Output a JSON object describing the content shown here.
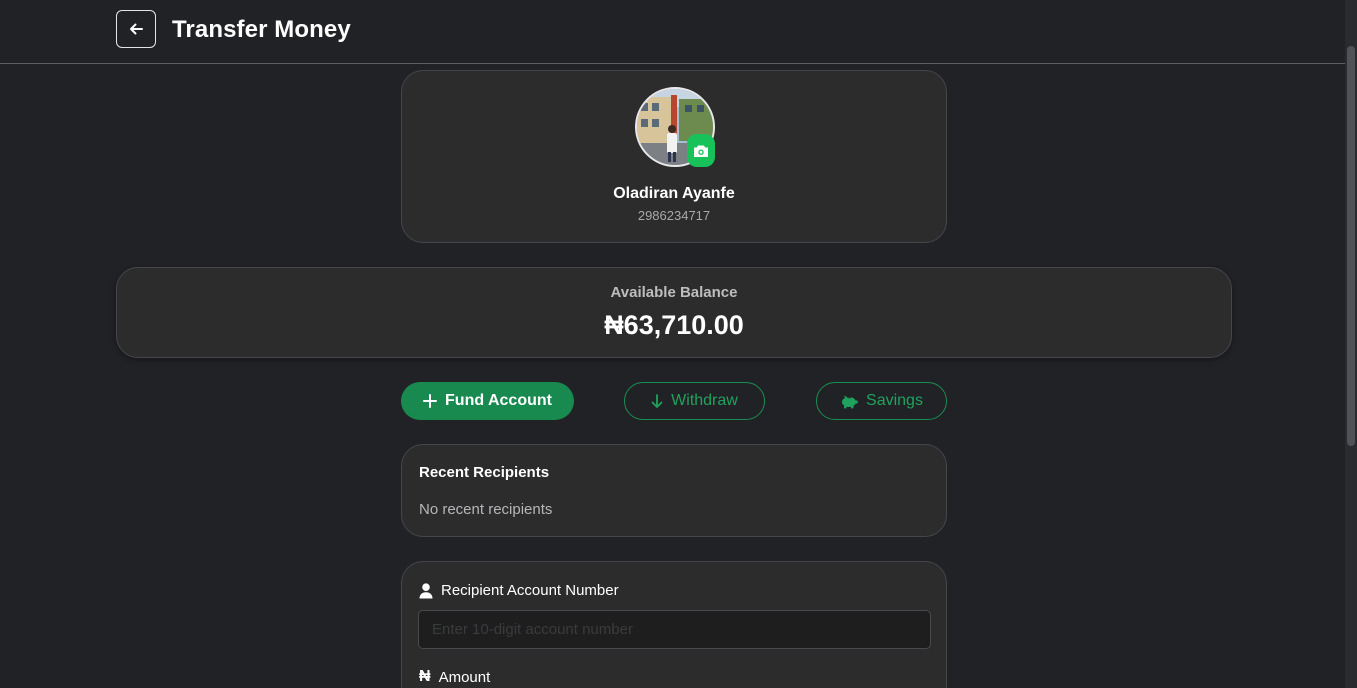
{
  "header": {
    "title": "Transfer Money"
  },
  "profile": {
    "name": "Oladiran Ayanfe",
    "account_number": "2986234717"
  },
  "balance": {
    "label": "Available Balance",
    "amount": "₦63,710.00"
  },
  "actions": {
    "fund_label": "Fund Account",
    "withdraw_label": "Withdraw",
    "savings_label": "Savings"
  },
  "recent": {
    "title": "Recent Recipients",
    "empty_text": "No recent recipients"
  },
  "form": {
    "account_label": "Recipient Account Number",
    "account_placeholder": "Enter 10-digit account number",
    "account_value": "",
    "amount_label": "Amount",
    "amount_icon": "₦"
  },
  "colors": {
    "background": "#212226",
    "card": "#2c2c2c",
    "accent_green": "#188a50",
    "badge_green": "#17c25a"
  }
}
